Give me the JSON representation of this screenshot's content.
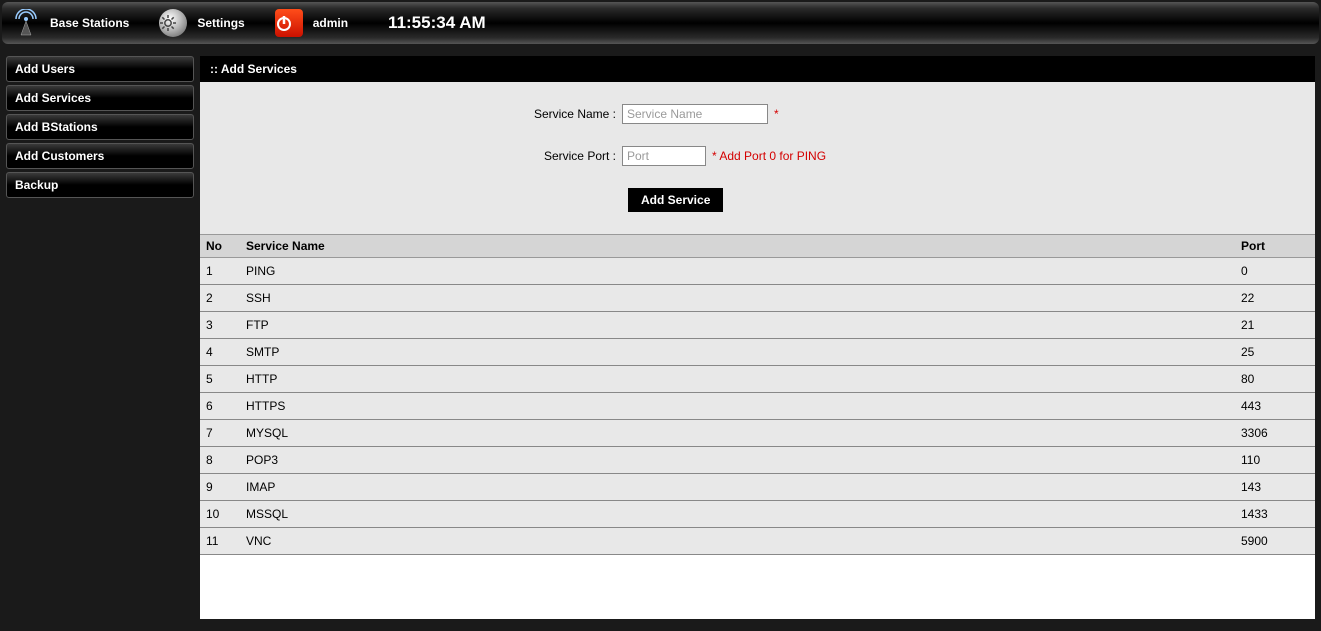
{
  "topbar": {
    "base_stations": "Base Stations",
    "settings": "Settings",
    "admin": "admin",
    "clock": "11:55:34 AM"
  },
  "sidebar": {
    "items": [
      {
        "label": "Add Users"
      },
      {
        "label": "Add Services"
      },
      {
        "label": "Add BStations"
      },
      {
        "label": "Add Customers"
      },
      {
        "label": "Backup"
      }
    ]
  },
  "panel": {
    "title": ":: Add Services",
    "service_name_label": "Service Name :",
    "service_name_placeholder": "Service Name",
    "service_name_required": "*",
    "service_port_label": "Service Port :",
    "service_port_placeholder": "Port",
    "service_port_hint": "* Add Port 0 for PING",
    "add_button": "Add Service",
    "table": {
      "headers": {
        "no": "No",
        "name": "Service Name",
        "port": "Port"
      },
      "rows": [
        {
          "no": "1",
          "name": "PING",
          "port": "0"
        },
        {
          "no": "2",
          "name": "SSH",
          "port": "22"
        },
        {
          "no": "3",
          "name": "FTP",
          "port": "21"
        },
        {
          "no": "4",
          "name": "SMTP",
          "port": "25"
        },
        {
          "no": "5",
          "name": "HTTP",
          "port": "80"
        },
        {
          "no": "6",
          "name": "HTTPS",
          "port": "443"
        },
        {
          "no": "7",
          "name": "MYSQL",
          "port": "3306"
        },
        {
          "no": "8",
          "name": "POP3",
          "port": "110"
        },
        {
          "no": "9",
          "name": "IMAP",
          "port": "143"
        },
        {
          "no": "10",
          "name": "MSSQL",
          "port": "1433"
        },
        {
          "no": "11",
          "name": "VNC",
          "port": "5900"
        }
      ]
    }
  }
}
